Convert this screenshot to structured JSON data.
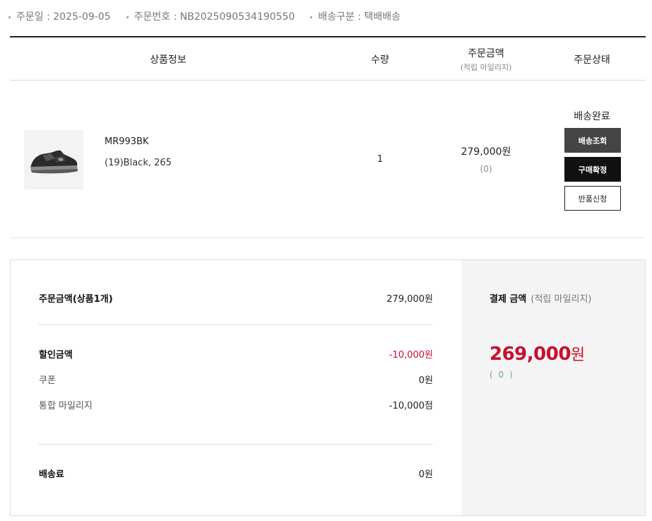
{
  "order_meta": {
    "order_date": "주문일 : 2025-09-05",
    "order_number": "주문번호 : NB2025090534190550",
    "delivery_type": "배송구분 : 택배배송"
  },
  "table": {
    "headers": {
      "product": "상품정보",
      "quantity": "수량",
      "amount": "주문금액",
      "amount_sub": "(적립 마일리지)",
      "status": "주문상태"
    },
    "item": {
      "name": "MR993BK",
      "option": "(19)Black, 265",
      "quantity": "1",
      "price": "279,000원",
      "mileage": "(0)",
      "status": "배송완료",
      "btn_track": "배송조회",
      "btn_confirm": "구매확정",
      "btn_return": "반품신청"
    }
  },
  "summary": {
    "order_amount_label": "주문금액(상품1개)",
    "order_amount_value": "279,000원",
    "discount_label": "할인금액",
    "discount_value": "-10,000원",
    "coupon_label": "쿠폰",
    "coupon_value": "0원",
    "mileage_label": "통합 마일리지",
    "mileage_value": "-10,000점",
    "shipping_label": "배송료",
    "shipping_value": "0원"
  },
  "payment": {
    "label": "결제 금액",
    "label_sub": "(적립 마일리지)",
    "amount": "269,000",
    "unit": "원",
    "mileage": "( 0 )"
  },
  "colors": {
    "accent_red": "#c8102e",
    "dark_button": "#444444",
    "black_button": "#111111"
  }
}
